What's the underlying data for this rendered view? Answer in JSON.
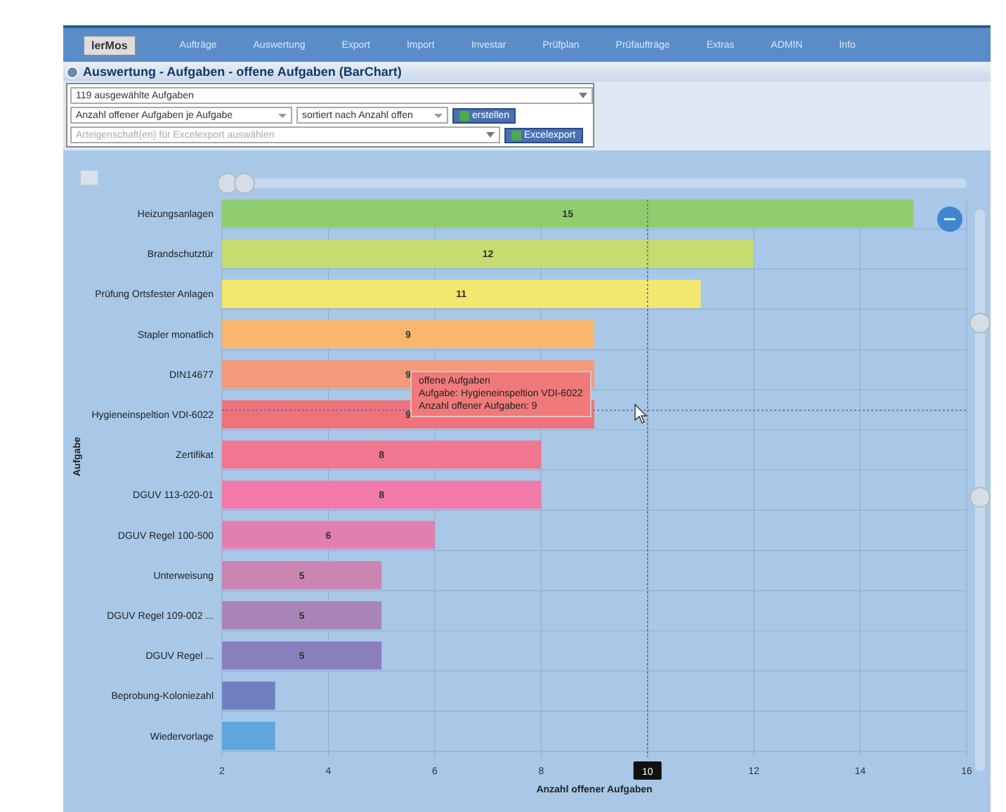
{
  "nav": {
    "logo": "lerMos",
    "items": [
      "Aufträge",
      "Auswertung",
      "Export",
      "Import",
      "Investar",
      "Prüfplan",
      "Prüfaufträge",
      "Extras",
      "ADMIN",
      "Info"
    ]
  },
  "title": "Auswertung - Aufgaben - offene Aufgaben (BarChart)",
  "selection": {
    "value": "119 ausgewählte Aufgaben"
  },
  "measure": {
    "value": "Anzahl offener Aufgaben je Aufgabe"
  },
  "sort": {
    "value": "sortiert nach Anzahl offen"
  },
  "create_button": "erstellen",
  "attributes": {
    "placeholder": "Arteigenschaft(en) für Excelexport auswählen"
  },
  "export_button": "Excelexport",
  "chart": {
    "chart_data": {
      "type": "bar",
      "orientation": "horizontal",
      "xlabel": "Anzahl offener Aufgaben",
      "ylabel": "Aufgabe",
      "xlim": [
        2,
        16
      ],
      "xticks": [
        2,
        4,
        6,
        8,
        10,
        12,
        14,
        16
      ],
      "categories": [
        "Heizungsanlagen",
        "Brandschutztür",
        "Prüfung Ortsfester Anlagen",
        "Stapler monatlich",
        "DIN14677",
        "Hygieneinspeltion VDI-6022",
        "Zertifikat",
        "DGUV 113-020-01",
        "DGUV Regel 100-500",
        "Unterweisung",
        "DGUV Regel 109-002 ...",
        "DGUV Regel ...",
        "Beprobung-Koloniezahl",
        "Wiedervorlage"
      ],
      "series": [
        {
          "name": "offene Aufgaben",
          "values": [
            15,
            12,
            11,
            9,
            9,
            9,
            8,
            8,
            6,
            5,
            5,
            5,
            3,
            3
          ],
          "colors": [
            "#8fcd6e",
            "#c5dc70",
            "#f3e76f",
            "#f8b76c",
            "#f49a7a",
            "#f0727a",
            "#f0778f",
            "#f27aa8",
            "#e27fb0",
            "#c985b0",
            "#a985b8",
            "#8a7fbc",
            "#6f7fc0",
            "#5ea6dc"
          ]
        }
      ],
      "value_labels": [
        "15",
        "12",
        "11",
        "9",
        "9",
        "9",
        "8",
        "8",
        "6",
        "5",
        "5",
        "5",
        null,
        null
      ],
      "grid": true
    },
    "tooltip": {
      "lines": [
        "Aufgabe: Hygieneinspeltion VDI-6022",
        "Anzahl offener Aufgaben: 9"
      ]
    },
    "crosshair_label": "10"
  }
}
